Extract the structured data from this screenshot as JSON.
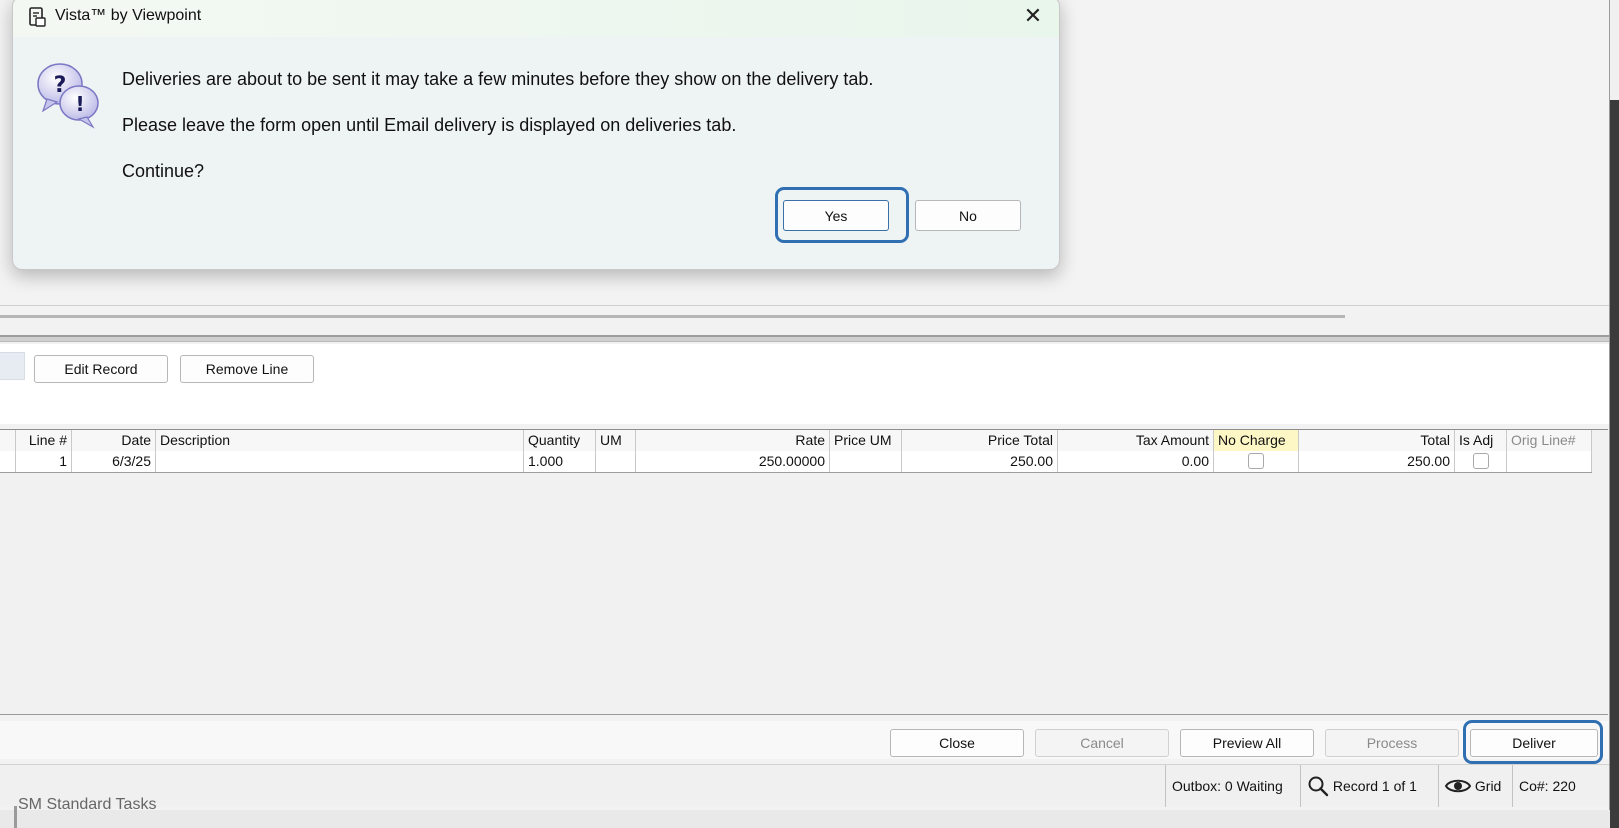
{
  "dialog": {
    "title": "Vista™ by Viewpoint",
    "message_line1": "Deliveries are about to be sent it may take a few minutes before they show on the delivery tab.",
    "message_line2": "Please leave the form open until Email delivery is displayed on deliveries tab.",
    "message_line3": "Continue?",
    "yes_label": "Yes",
    "no_label": "No",
    "close_glyph": "✕"
  },
  "toolbar": {
    "edit_record_label": "Edit Record",
    "remove_line_label": "Remove Line"
  },
  "grid": {
    "columns": {
      "line": "Line #",
      "date": "Date",
      "description": "Description",
      "quantity": "Quantity",
      "um": "UM",
      "rate": "Rate",
      "price_um": "Price UM",
      "price_total": "Price Total",
      "tax_amount": "Tax Amount",
      "no_charge": "No Charge",
      "total": "Total",
      "is_adj": "Is Adj",
      "orig_line": "Orig Line#"
    },
    "rows": [
      {
        "line": "1",
        "date": "6/3/25",
        "description": "",
        "quantity": "1.000",
        "um": "",
        "rate": "250.00000",
        "price_um": "",
        "price_total": "250.00",
        "tax_amount": "0.00",
        "no_charge": false,
        "total": "250.00",
        "is_adj": false,
        "orig_line": ""
      }
    ]
  },
  "actions": {
    "close_label": "Close",
    "cancel_label": "Cancel",
    "preview_all_label": "Preview All",
    "process_label": "Process",
    "deliver_label": "Deliver"
  },
  "status": {
    "outbox": "Outbox: 0 Waiting",
    "record": "Record 1 of 1",
    "view": "Grid",
    "company": "Co#: 220"
  },
  "underlay": {
    "text": "SM Standard Tasks"
  },
  "colors": {
    "highlight_outline": "#2f6fb2",
    "no_charge_header_bg": "#fdf7c6"
  }
}
